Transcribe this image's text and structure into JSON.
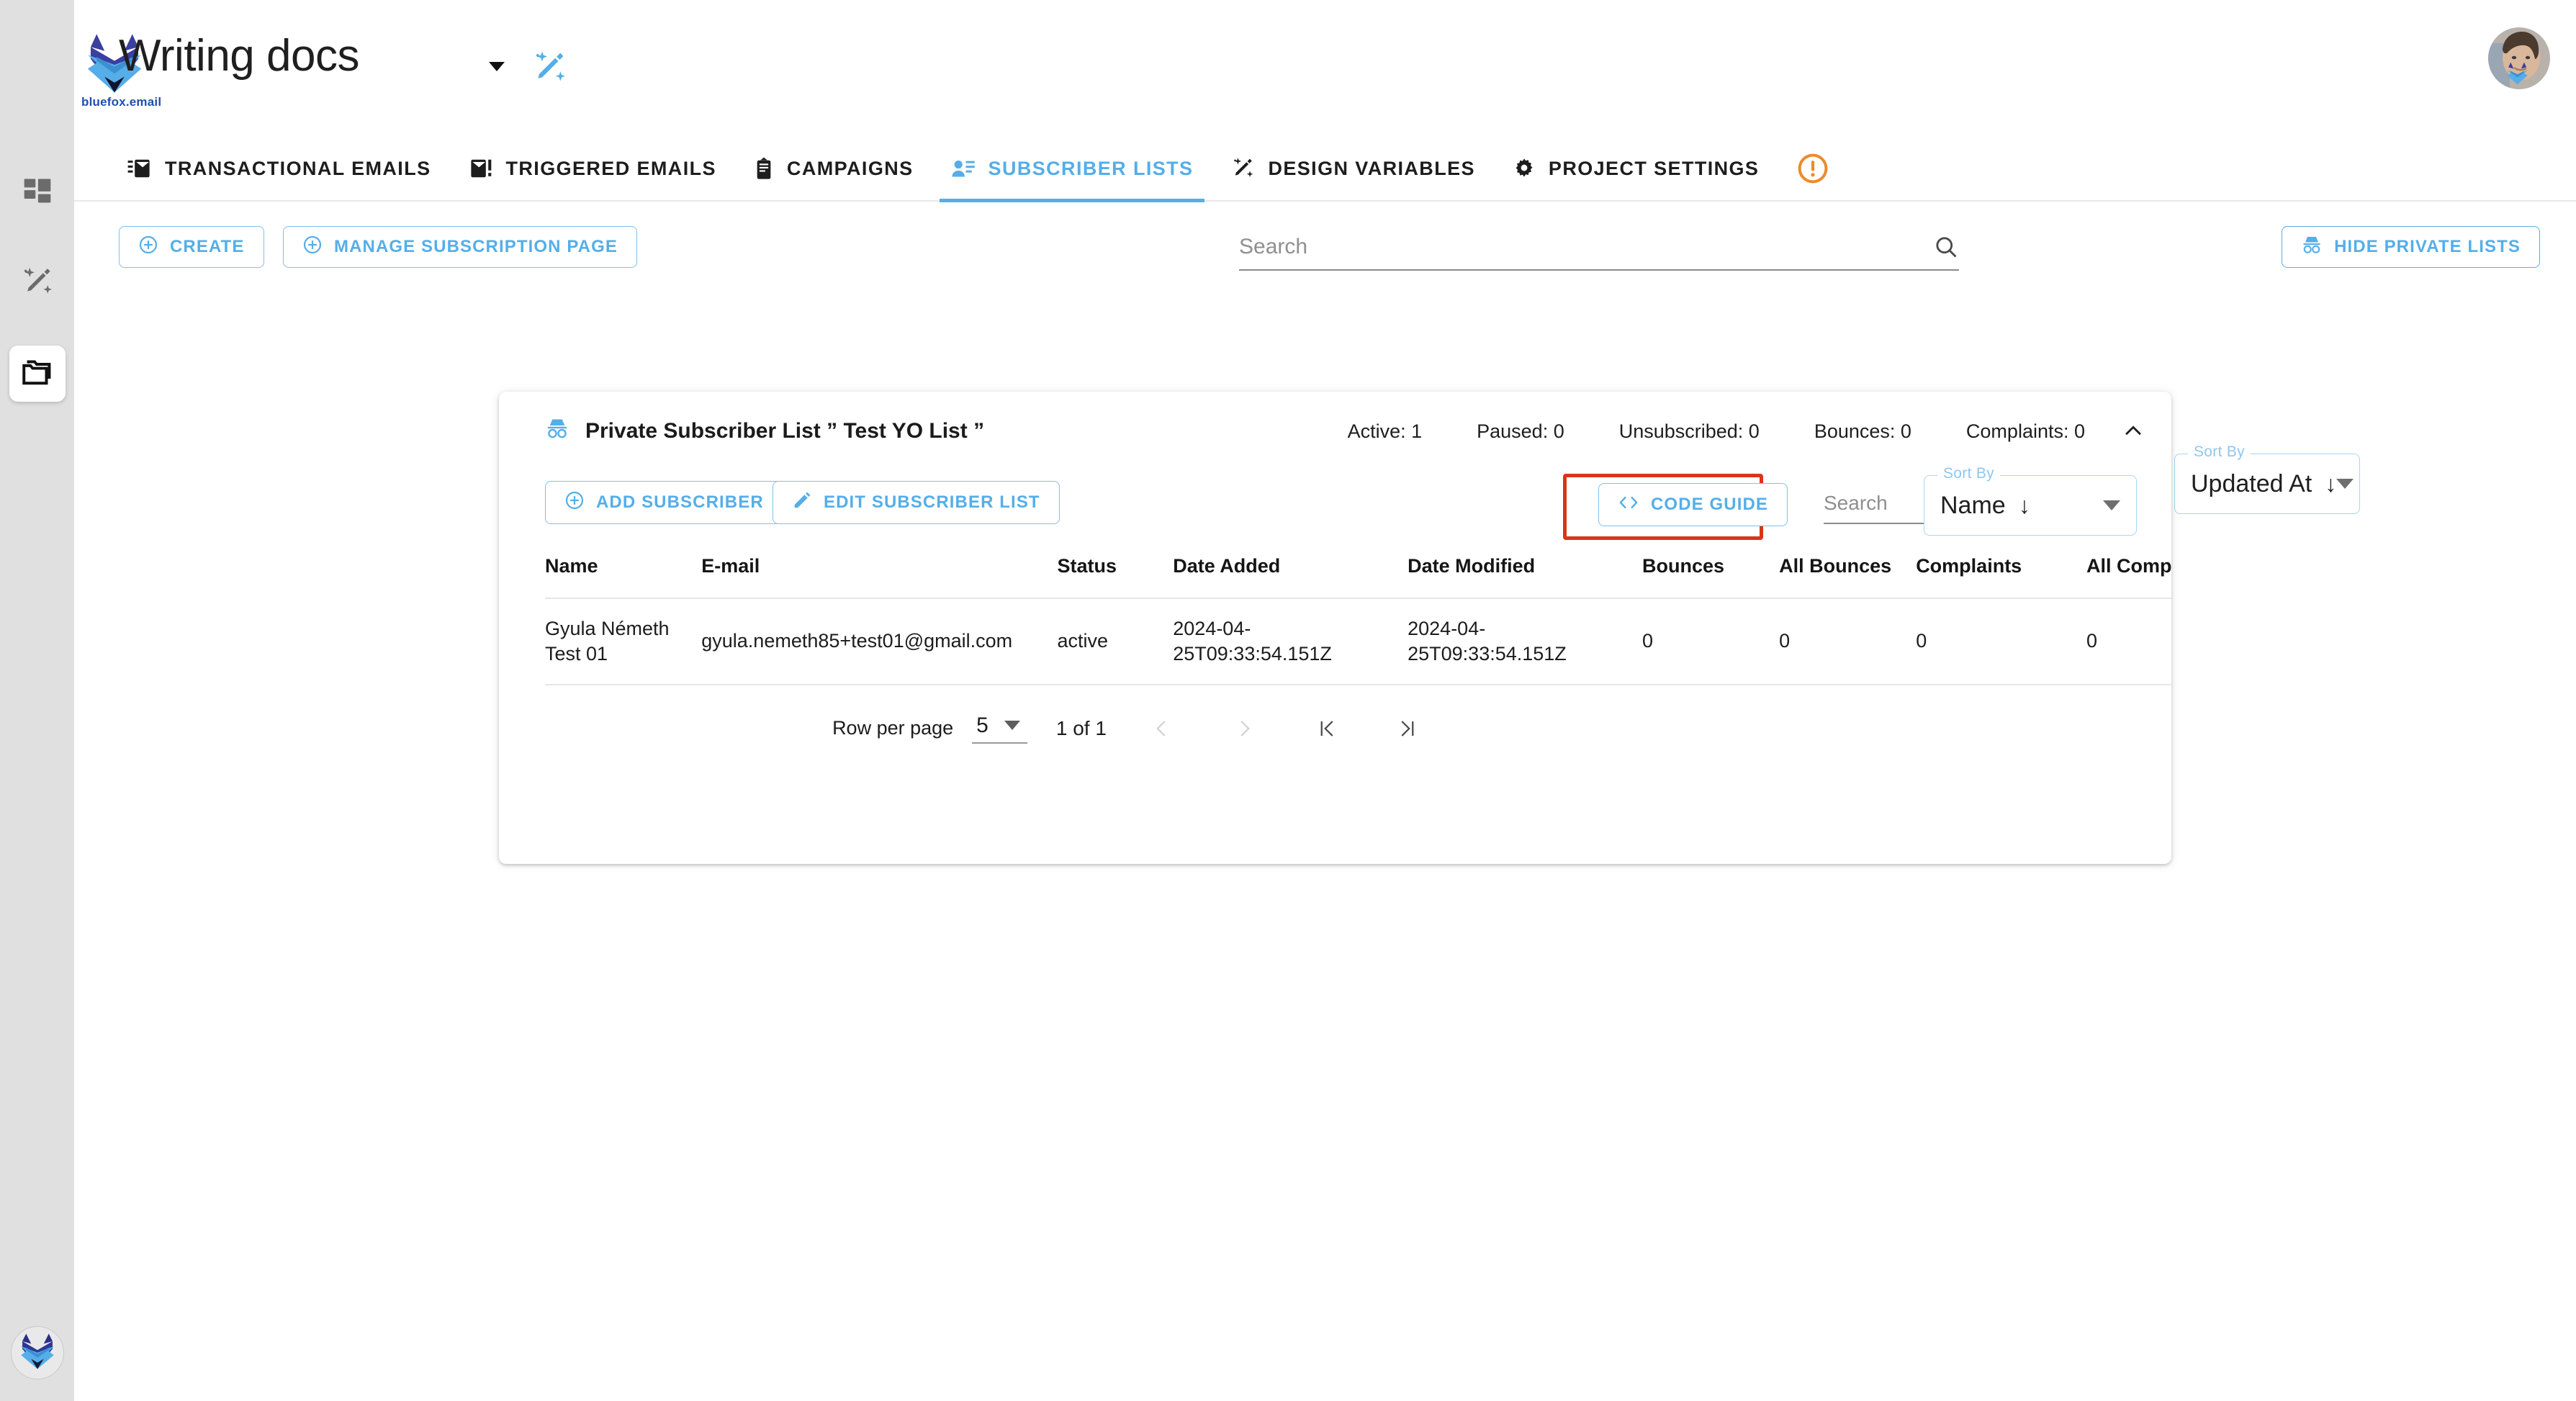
{
  "brand": {
    "caption": "bluefox.email"
  },
  "header": {
    "title": "Writing docs",
    "caret_icon": "chevron-down-icon",
    "wand_icon": "magic-wand-icon",
    "avatar_icon": "user-avatar"
  },
  "rail": {
    "items": [
      {
        "icon": "dashboard-grid-icon",
        "active": false
      },
      {
        "icon": "magic-wand-icon",
        "active": false
      },
      {
        "icon": "folders-icon",
        "active": true
      }
    ],
    "logo_icon": "bluefox-logo-icon"
  },
  "tabs": [
    {
      "id": "transactional-emails",
      "label": "TRANSACTIONAL EMAILS",
      "icon": "transactional-email-icon",
      "active": false
    },
    {
      "id": "triggered-emails",
      "label": "TRIGGERED EMAILS",
      "icon": "triggered-email-icon",
      "active": false
    },
    {
      "id": "campaigns",
      "label": "CAMPAIGNS",
      "icon": "campaign-icon",
      "active": false
    },
    {
      "id": "subscriber-lists",
      "label": "SUBSCRIBER LISTS",
      "icon": "subscriber-list-icon",
      "active": true
    },
    {
      "id": "design-variables",
      "label": "DESIGN VARIABLES",
      "icon": "design-variables-icon",
      "active": false
    },
    {
      "id": "project-settings",
      "label": "PROJECT SETTINGS",
      "icon": "gear-icon",
      "active": false
    }
  ],
  "tabs_warning_icon": "warning-exclamation-icon",
  "toolbar": {
    "create_label": "CREATE",
    "manage_label": "MANAGE SUBSCRIPTION PAGE",
    "hide_private_label": "HIDE PRIVATE LISTS",
    "search_placeholder": "Search",
    "search_value": "",
    "sort_legend": "Sort By",
    "sort_value": "Updated At",
    "sort_direction_glyph": "↓"
  },
  "card": {
    "list_icon": "incognito-private-icon",
    "title": "Private Subscriber List ” Test YO List ”",
    "stats": [
      {
        "label": "Active: 1"
      },
      {
        "label": "Paused: 0"
      },
      {
        "label": "Unsubscribed: 0"
      },
      {
        "label": "Bounces: 0"
      },
      {
        "label": "Complaints: 0"
      }
    ],
    "collapse_icon": "chevron-up-icon",
    "actions": {
      "add_subscriber_label": "ADD SUBSCRIBER",
      "edit_subscriber_list_label": "EDIT SUBSCRIBER LIST",
      "code_guide_label": "CODE GUIDE",
      "highlight_color": "#d8351a"
    },
    "search_placeholder": "Search",
    "search_value": "",
    "sort_legend": "Sort By",
    "sort_value": "Name",
    "sort_direction_glyph": "↓"
  },
  "table": {
    "columns": [
      "Name",
      "E-mail",
      "Status",
      "Date Added",
      "Date Modified",
      "Bounces",
      "All Bounces",
      "Complaints",
      "All Complaints"
    ],
    "rows": [
      {
        "name": "Gyula Németh Test 01",
        "email": "gyula.nemeth85+test01@gmail.com",
        "status": "active",
        "date_added": "2024-04-25T09:33:54.151Z",
        "date_modified": "2024-04-25T09:33:54.151Z",
        "bounces": "0",
        "all_bounces": "0",
        "complaints": "0",
        "all_complaints": "0"
      }
    ]
  },
  "pagination": {
    "rows_per_page_label": "Row per page",
    "rows_per_page_value": "5",
    "page_info": "1 of 1",
    "prev_icon": "chevron-left-icon",
    "next_icon": "chevron-right-icon",
    "first_icon": "first-page-icon",
    "last_icon": "last-page-icon"
  },
  "colors": {
    "accent": "#55aee8",
    "warning": "#ee8a2b",
    "highlight": "#d8351a",
    "rail_bg": "#e0e0e0"
  }
}
